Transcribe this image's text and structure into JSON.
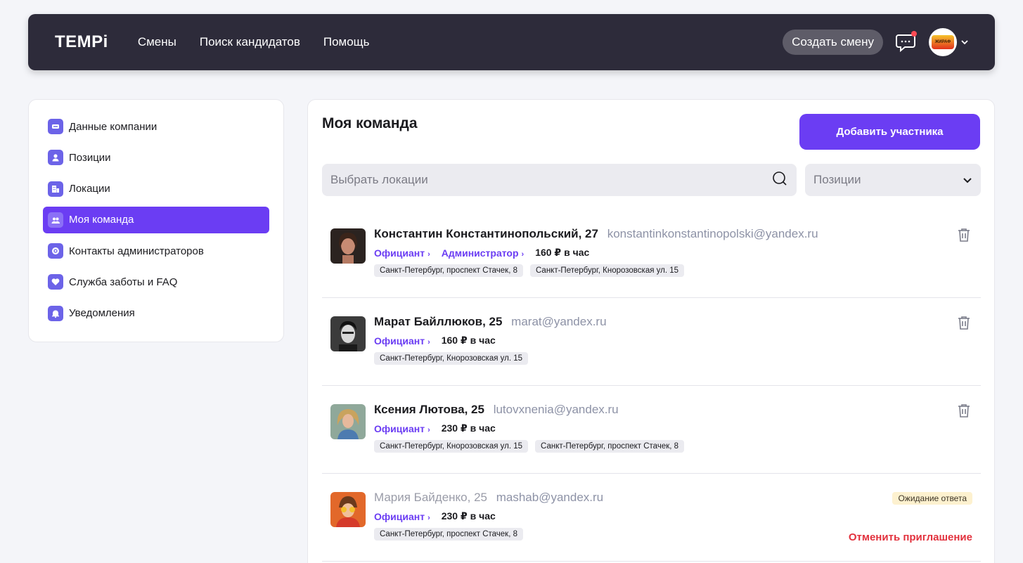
{
  "header": {
    "logo": "TEMPi",
    "nav": [
      "Смены",
      "Поиск кандидатов",
      "Помощь"
    ],
    "create_shift": "Создать смену",
    "chat_icon": "chat-bubble-icon",
    "avatar_text": "ЖИРАФ"
  },
  "sidebar": {
    "items": [
      {
        "label": "Данные компании",
        "icon": "company-card-icon"
      },
      {
        "label": "Позиции",
        "icon": "person-icon"
      },
      {
        "label": "Локации",
        "icon": "building-icon"
      },
      {
        "label": "Моя команда",
        "icon": "team-icon",
        "active": true
      },
      {
        "label": "Контакты администраторов",
        "icon": "at-icon"
      },
      {
        "label": "Служба заботы и FAQ",
        "icon": "heart-icon"
      },
      {
        "label": "Уведомления",
        "icon": "bell-icon"
      }
    ]
  },
  "main": {
    "title": "Моя команда",
    "add_button": "Добавить участника",
    "search_placeholder": "Выбрать локации",
    "positions_placeholder": "Позиции"
  },
  "members": [
    {
      "name": "Константин Константинопольский, 27",
      "email": "konstantinkonstantinopolski@yandex.ru",
      "roles": [
        "Официант",
        "Администратор"
      ],
      "rate": "160 ₽ в час",
      "locations": [
        "Санкт-Петербург, проспект Стачек, 8",
        "Санкт-Петербург, Кнорозовская ул. 15"
      ]
    },
    {
      "name": "Марат Байллюков, 25",
      "email": "marat@yandex.ru",
      "roles": [
        "Официант"
      ],
      "rate": "160 ₽ в час",
      "locations": [
        "Санкт-Петербург, Кнорозовская ул. 15"
      ]
    },
    {
      "name": "Ксения Лютова, 25",
      "email": "lutovxnenia@yandex.ru",
      "roles": [
        "Официант"
      ],
      "rate": "230 ₽ в час",
      "locations": [
        "Санкт-Петербург, Кнорозовская ул. 15",
        "Санкт-Петербург, проспект Стачек, 8"
      ]
    },
    {
      "name": "Мария Байденко, 25",
      "email": "mashab@yandex.ru",
      "roles": [
        "Официант"
      ],
      "rate": "230 ₽ в час",
      "locations": [
        "Санкт-Петербург, проспект Стачек, 8"
      ],
      "status": "Ожидание ответа",
      "cancel": "Отменить приглашение"
    }
  ],
  "colors": {
    "accent": "#6b3df3",
    "header_bg": "#2d2b3a",
    "danger": "#e2313d",
    "badge_bg": "#fdf1cf"
  }
}
